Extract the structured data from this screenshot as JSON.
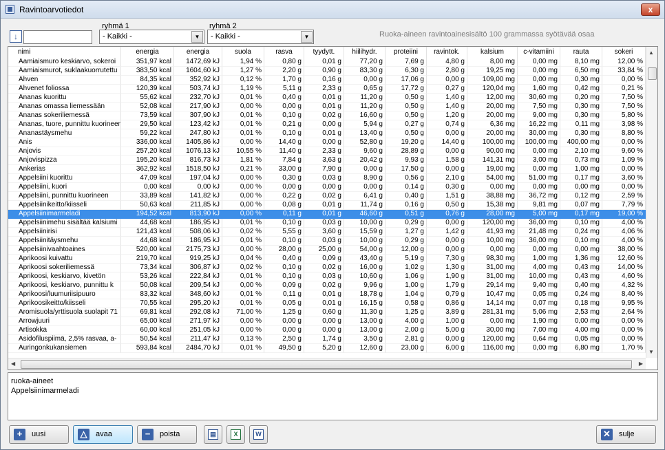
{
  "window": {
    "title": "Ravintoarvotiedot",
    "close_label": "x"
  },
  "filter": {
    "value": ""
  },
  "group1": {
    "label": "ryhmä 1",
    "selected": "- Kaikki -"
  },
  "group2": {
    "label": "ryhmä 2",
    "selected": "- Kaikki -"
  },
  "info_text": "Ruoka-aineen ravintoainesisältö 100 grammassa syötävää osaa",
  "columns": [
    "nimi",
    "energia",
    "energia",
    "suola",
    "rasva",
    "tyydytt.",
    "hiilihydr.",
    "proteiini",
    "ravintok.",
    "kalsium",
    "c-vitamiini",
    "rauta",
    "sokeri"
  ],
  "rows": [
    [
      "Aamiaismuro keskiarvo, sokeroi",
      "351,97 kcal",
      "1472,69 kJ",
      "1,94 %",
      "0,80 g",
      "0,01 g",
      "77,20 g",
      "7,69 g",
      "4,80 g",
      "8,00 mg",
      "0,00 mg",
      "8,10 mg",
      "12,00 %"
    ],
    [
      "Aamiaismurot, suklaakuorrutettu",
      "383,50 kcal",
      "1604,60 kJ",
      "1,27 %",
      "2,20 g",
      "0,90 g",
      "83,30 g",
      "6,30 g",
      "2,80 g",
      "19,25 mg",
      "0,00 mg",
      "6,50 mg",
      "33,84 %"
    ],
    [
      "Ahven",
      "84,35 kcal",
      "352,92 kJ",
      "0,12 %",
      "1,70 g",
      "0,16 g",
      "0,00 g",
      "17,06 g",
      "0,00 g",
      "109,00 mg",
      "0,00 mg",
      "0,30 mg",
      "0,00 %"
    ],
    [
      "Ahvenet foliossa",
      "120,39 kcal",
      "503,74 kJ",
      "1,19 %",
      "5,11 g",
      "2,33 g",
      "0,65 g",
      "17,72 g",
      "0,27 g",
      "120,04 mg",
      "1,60 mg",
      "0,42 mg",
      "0,21 %"
    ],
    [
      "Ananas kuorittu",
      "55,62 kcal",
      "232,70 kJ",
      "0,01 %",
      "0,40 g",
      "0,01 g",
      "11,20 g",
      "0,50 g",
      "1,40 g",
      "12,00 mg",
      "30,60 mg",
      "0,20 mg",
      "7,50 %"
    ],
    [
      "Ananas omassa liemessään",
      "52,08 kcal",
      "217,90 kJ",
      "0,00 %",
      "0,00 g",
      "0,01 g",
      "11,20 g",
      "0,50 g",
      "1,40 g",
      "20,00 mg",
      "7,50 mg",
      "0,30 mg",
      "7,50 %"
    ],
    [
      "Ananas sokeriliemessä",
      "73,59 kcal",
      "307,90 kJ",
      "0,01 %",
      "0,10 g",
      "0,02 g",
      "16,60 g",
      "0,50 g",
      "1,20 g",
      "20,00 mg",
      "9,00 mg",
      "0,30 mg",
      "5,80 %"
    ],
    [
      "Ananas, tuore, punnittu kuorineen",
      "29,50 kcal",
      "123,42 kJ",
      "0,01 %",
      "0,21 g",
      "0,00 g",
      "5,94 g",
      "0,27 g",
      "0,74 g",
      "6,36 mg",
      "16,22 mg",
      "0,11 mg",
      "3,98 %"
    ],
    [
      "Ananastäysmehu",
      "59,22 kcal",
      "247,80 kJ",
      "0,01 %",
      "0,10 g",
      "0,01 g",
      "13,40 g",
      "0,50 g",
      "0,00 g",
      "20,00 mg",
      "30,00 mg",
      "0,30 mg",
      "8,80 %"
    ],
    [
      "Anis",
      "336,00 kcal",
      "1405,86 kJ",
      "0,00 %",
      "14,40 g",
      "0,00 g",
      "52,80 g",
      "19,20 g",
      "14,40 g",
      "100,00 mg",
      "100,00 mg",
      "400,00 mg",
      "0,00 %"
    ],
    [
      "Anjovis",
      "257,20 kcal",
      "1076,13 kJ",
      "10,55 %",
      "11,40 g",
      "2,33 g",
      "9,60 g",
      "28,89 g",
      "0,00 g",
      "90,00 mg",
      "0,00 mg",
      "2,10 mg",
      "9,60 %"
    ],
    [
      "Anjovispizza",
      "195,20 kcal",
      "816,73 kJ",
      "1,81 %",
      "7,84 g",
      "3,63 g",
      "20,42 g",
      "9,93 g",
      "1,58 g",
      "141,31 mg",
      "3,00 mg",
      "0,73 mg",
      "1,09 %"
    ],
    [
      "Ankerias",
      "362,92 kcal",
      "1518,50 kJ",
      "0,21 %",
      "33,00 g",
      "7,90 g",
      "0,00 g",
      "17,50 g",
      "0,00 g",
      "19,00 mg",
      "0,00 mg",
      "1,00 mg",
      "0,00 %"
    ],
    [
      "Appelsiini kuorittu",
      "47,09 kcal",
      "197,04 kJ",
      "0,00 %",
      "0,30 g",
      "0,03 g",
      "8,90 g",
      "0,56 g",
      "2,10 g",
      "54,00 mg",
      "51,00 mg",
      "0,17 mg",
      "3,60 %"
    ],
    [
      "Appelsiini, kuori",
      "0,00 kcal",
      "0,00 kJ",
      "0,00 %",
      "0,00 g",
      "0,00 g",
      "0,00 g",
      "0,14 g",
      "0,30 g",
      "0,00 mg",
      "0,00 mg",
      "0,00 mg",
      "0,00 %"
    ],
    [
      "Appelsiini, punnittu kuorineen",
      "33,89 kcal",
      "141,82 kJ",
      "0,00 %",
      "0,22 g",
      "0,02 g",
      "6,41 g",
      "0,40 g",
      "1,51 g",
      "38,88 mg",
      "36,72 mg",
      "0,12 mg",
      "2,59 %"
    ],
    [
      "Appelsiinikeitto/kiisseli",
      "50,63 kcal",
      "211,85 kJ",
      "0,00 %",
      "0,08 g",
      "0,01 g",
      "11,74 g",
      "0,16 g",
      "0,50 g",
      "15,38 mg",
      "9,81 mg",
      "0,07 mg",
      "7,79 %"
    ],
    [
      "Appelsiinimarmeladi",
      "194,52 kcal",
      "813,90 kJ",
      "0,00 %",
      "0,11 g",
      "0,01 g",
      "46,60 g",
      "0,51 g",
      "0,76 g",
      "28,00 mg",
      "5,00 mg",
      "0,17 mg",
      "19,00 %"
    ],
    [
      "Appelsiinimehu sisältää kalsiumi",
      "44,68 kcal",
      "186,95 kJ",
      "0,01 %",
      "0,10 g",
      "0,03 g",
      "10,00 g",
      "0,29 g",
      "0,00 g",
      "120,00 mg",
      "36,00 mg",
      "0,10 mg",
      "4,00 %"
    ],
    [
      "Appelsiinirisi",
      "121,43 kcal",
      "508,06 kJ",
      "0,02 %",
      "5,55 g",
      "3,60 g",
      "15,59 g",
      "1,27 g",
      "1,42 g",
      "41,93 mg",
      "21,48 mg",
      "0,24 mg",
      "4,06 %"
    ],
    [
      "Appelsiinitäysmehu",
      "44,68 kcal",
      "186,95 kJ",
      "0,01 %",
      "0,10 g",
      "0,03 g",
      "10,00 g",
      "0,29 g",
      "0,00 g",
      "10,00 mg",
      "36,00 mg",
      "0,10 mg",
      "4,00 %"
    ],
    [
      "Appelsiinivaahtoaines",
      "520,00 kcal",
      "2175,73 kJ",
      "0,00 %",
      "28,00 g",
      "25,00 g",
      "54,00 g",
      "12,00 g",
      "0,00 g",
      "0,00 mg",
      "0,00 mg",
      "0,00 mg",
      "38,00 %"
    ],
    [
      "Aprikoosi kuivattu",
      "219,70 kcal",
      "919,25 kJ",
      "0,04 %",
      "0,40 g",
      "0,09 g",
      "43,40 g",
      "5,19 g",
      "7,30 g",
      "98,30 mg",
      "1,00 mg",
      "1,36 mg",
      "12,60 %"
    ],
    [
      "Aprikoosi sokeriliemessä",
      "73,34 kcal",
      "306,87 kJ",
      "0,02 %",
      "0,10 g",
      "0,02 g",
      "16,00 g",
      "1,02 g",
      "1,30 g",
      "31,00 mg",
      "4,00 mg",
      "0,43 mg",
      "14,00 %"
    ],
    [
      "Aprikoosi, keskiarvo,  kivetön",
      "53,26 kcal",
      "222,84 kJ",
      "0,01 %",
      "0,10 g",
      "0,03 g",
      "10,60 g",
      "1,06 g",
      "1,90 g",
      "31,00 mg",
      "10,00 mg",
      "0,43 mg",
      "4,60 %"
    ],
    [
      "Aprikoosi, keskiarvo, punnittu k",
      "50,08 kcal",
      "209,54 kJ",
      "0,00 %",
      "0,09 g",
      "0,02 g",
      "9,96 g",
      "1,00 g",
      "1,79 g",
      "29,14 mg",
      "9,40 mg",
      "0,40 mg",
      "4,32 %"
    ],
    [
      "Aprikoosi/luumuriisipuuro",
      "83,32 kcal",
      "348,60 kJ",
      "0,01 %",
      "0,11 g",
      "0,01 g",
      "18,78 g",
      "1,04 g",
      "0,79 g",
      "10,47 mg",
      "0,05 mg",
      "0,24 mg",
      "8,40 %"
    ],
    [
      "Aprikoosikeitto/kiisseli",
      "70,55 kcal",
      "295,20 kJ",
      "0,01 %",
      "0,05 g",
      "0,01 g",
      "16,15 g",
      "0,58 g",
      "0,86 g",
      "14,14 mg",
      "0,07 mg",
      "0,18 mg",
      "9,95 %"
    ],
    [
      "Aromisuola/yrttisuola suolapit 71",
      "69,81 kcal",
      "292,08 kJ",
      "71,00 %",
      "1,25 g",
      "0,60 g",
      "11,30 g",
      "1,25 g",
      "3,89 g",
      "281,31 mg",
      "5,06 mg",
      "2,53 mg",
      "2,64 %"
    ],
    [
      "Arrowjuuri",
      "65,00 kcal",
      "271,97 kJ",
      "0,00 %",
      "0,00 g",
      "0,00 g",
      "13,00 g",
      "4,00 g",
      "1,00 g",
      "0,00 mg",
      "1,90 mg",
      "0,00 mg",
      "0,00 %"
    ],
    [
      "Artisokka",
      "60,00 kcal",
      "251,05 kJ",
      "0,00 %",
      "0,00 g",
      "0,00 g",
      "13,00 g",
      "2,00 g",
      "5,00 g",
      "30,00 mg",
      "7,00 mg",
      "4,00 mg",
      "0,00 %"
    ],
    [
      "Asidofiluspiimä, 2,5% rasvaa, a-",
      "50,54 kcal",
      "211,47 kJ",
      "0,13 %",
      "2,50 g",
      "1,74 g",
      "3,50 g",
      "2,81 g",
      "0,00 g",
      "120,00 mg",
      "0,64 mg",
      "0,05 mg",
      "0,00 %"
    ],
    [
      "Auringonkukansiemen",
      "593,84 kcal",
      "2484,70 kJ",
      "0,01 %",
      "49,50 g",
      "5,20 g",
      "12,60 g",
      "23,00 g",
      "6,00 g",
      "116,00 mg",
      "0,00 mg",
      "6,80 mg",
      "1,70 %"
    ]
  ],
  "selected_index": 17,
  "detail": {
    "label": "ruoka-aineet",
    "value": "Appelsiinimarmeladi"
  },
  "buttons": {
    "new": "uusi",
    "open": "avaa",
    "delete": "poista",
    "close": "sulje"
  },
  "colors": {
    "selection": "#3d8ee8",
    "accent": "#3b63a8"
  }
}
